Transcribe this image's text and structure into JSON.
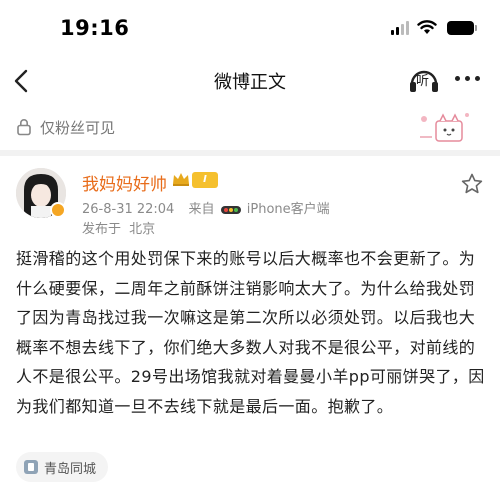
{
  "status_bar": {
    "time": "19:16",
    "icons": [
      "signal-icon",
      "wifi-icon",
      "battery-icon"
    ]
  },
  "nav": {
    "back_icon": "chevron-left-icon",
    "title": "微博正文",
    "listen_label": "听",
    "more_icon": "ellipsis-icon"
  },
  "visibility": {
    "icon": "lock-icon",
    "label": "仅粉丝可见"
  },
  "post": {
    "author": {
      "name": "我妈妈好帅",
      "level": "I",
      "verified": true
    },
    "date": "26-8-31 22:04",
    "source_prefix": "来自",
    "source_client": "iPhone客户端",
    "location_prefix": "发布于",
    "location": "北京",
    "body": "挺滑稽的这个用处罚保下来的账号以后大概率也不会更新了。为什么硬要保，二周年之前酥饼注销影响太大了。为什么给我处罚了因为青岛找过我一次嘛这是第二次所以必须处罚。以后我也大概率不想去线下了，你们绝大多数人对我不是很公平，对前线的人不是很公平。29号出场馆我就对着曼曼小羊pp可丽饼哭了，因为我们都知道一旦不去线下就是最后一面。抱歉了。",
    "topic_tag": "青岛同城"
  },
  "colors": {
    "accent": "#e86c1a",
    "meta": "#8a8a8a",
    "badge": "#f5c02e"
  }
}
